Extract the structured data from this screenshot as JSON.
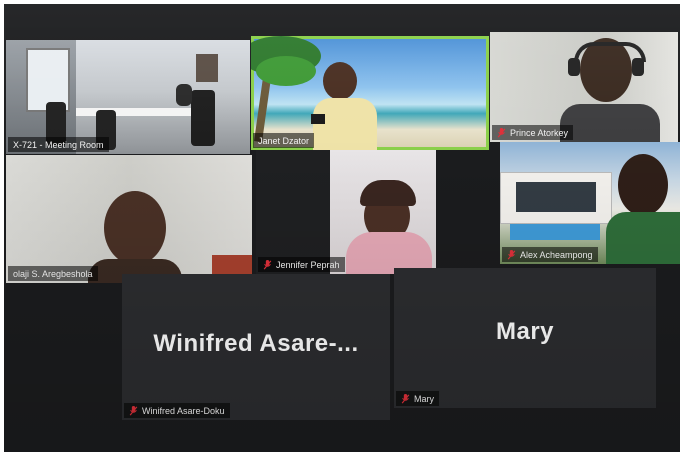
{
  "participants": {
    "meeting_room": {
      "label": "X-721 - Meeting Room",
      "muted": false
    },
    "janet": {
      "label": "Janet Dzator",
      "muted": false,
      "active_speaker": true
    },
    "prince": {
      "label": "Prince Atorkey",
      "muted": true
    },
    "folaji": {
      "label": "olaji S. Aregbeshola",
      "muted": false
    },
    "jennifer": {
      "label": "Jennifer Peprah",
      "muted": true
    },
    "alex": {
      "label": "Alex Acheampong",
      "muted": true
    },
    "winifred": {
      "label": "Winifred Asare-Doku",
      "display_name": "Winifred  Asare-...",
      "muted": true,
      "video": false
    },
    "mary": {
      "label": "Mary",
      "display_name": "Mary",
      "muted": true,
      "video": false
    }
  },
  "colors": {
    "active_border": "#8bd04a",
    "muted_icon": "#e0303a",
    "tile_bg": "#2b2c2f"
  },
  "icons": {
    "muted": "mic-muted-icon"
  }
}
